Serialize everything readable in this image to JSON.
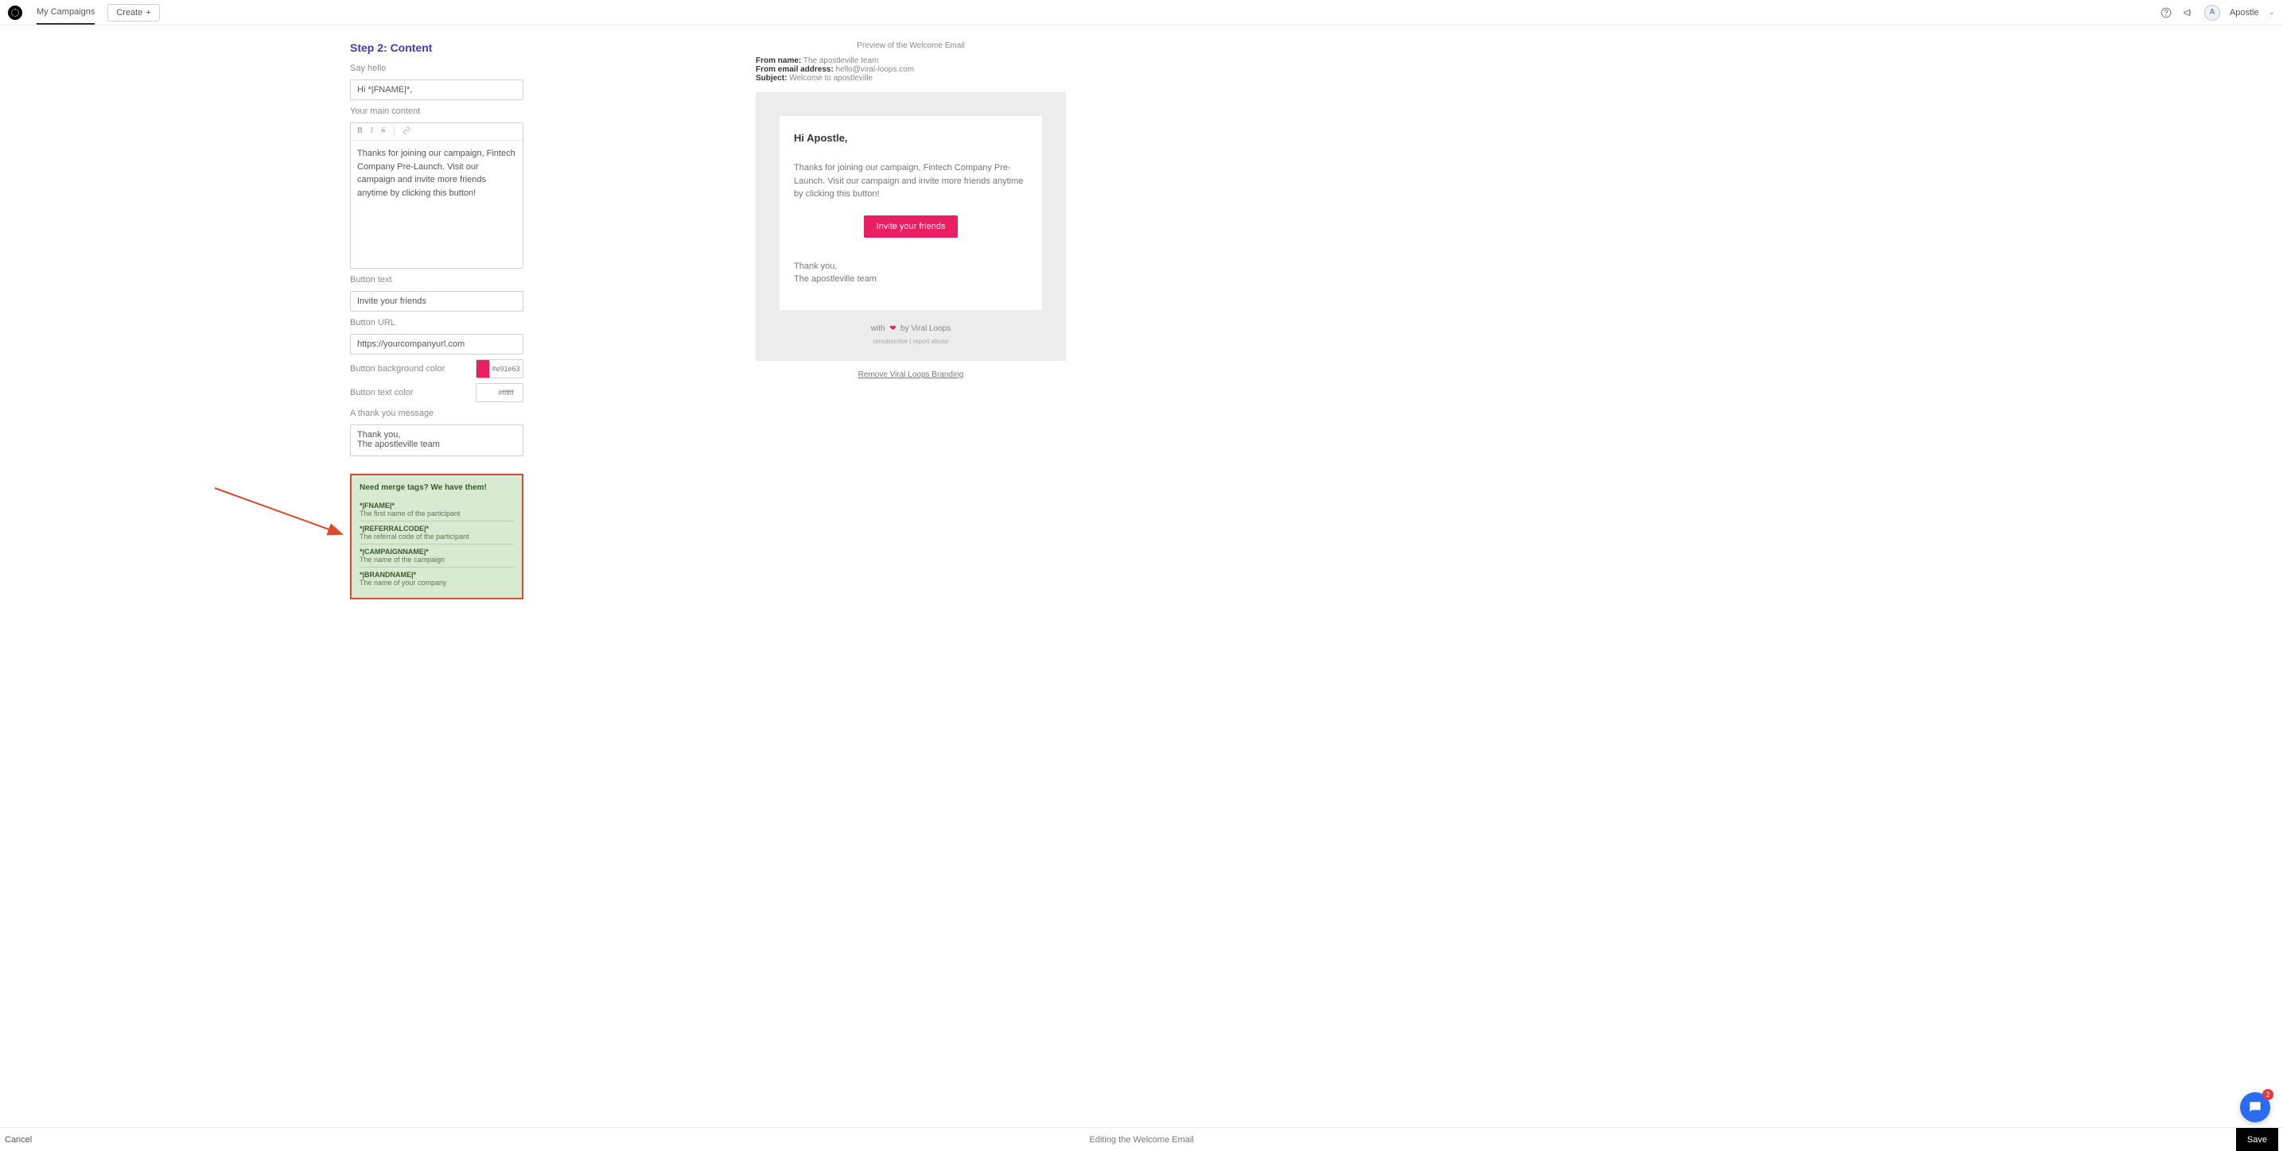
{
  "nav": {
    "link_campaigns": "My Campaigns",
    "create_label": "Create",
    "username": "Apostle",
    "avatar_initial": "A"
  },
  "form": {
    "step_title": "Step 2: Content",
    "say_hello_label": "Say hello",
    "say_hello_value": "Hi *|FNAME|*,",
    "main_content_label": "Your main content",
    "main_content_value": "Thanks for joining our campaign, Fintech Company Pre-Launch. Visit our campaign and invite more friends anytime by clicking this button!",
    "button_text_label": "Button text",
    "button_text_value": "Invite your friends",
    "button_url_label": "Button URL",
    "button_url_value": "https://yourcompanyurl.com",
    "bg_color_label": "Button background color",
    "bg_color_value": "#e91e63",
    "text_color_label": "Button text color",
    "text_color_value": "#ffffff",
    "thank_you_label": "A thank you message",
    "thank_you_line1": "Thank you,",
    "thank_you_line2": "The apostleville team"
  },
  "merge": {
    "title": "Need merge tags? We have them!",
    "tags": [
      {
        "tag": "*|FNAME|*",
        "desc": "The first name of the participant"
      },
      {
        "tag": "*|REFERRALCODE|*",
        "desc": "The referral code of the participant"
      },
      {
        "tag": "*|CAMPAIGNNAME|*",
        "desc": "The name of the campaign"
      },
      {
        "tag": "*|BRANDNAME|*",
        "desc": "The name of your company"
      }
    ]
  },
  "preview": {
    "title": "Preview of the Welcome Email",
    "from_name_label": "From name:",
    "from_name_value": "The apostleville team",
    "from_email_label": "From email address:",
    "from_email_value": "hello@viral-loops.com",
    "subject_label": "Subject:",
    "subject_value": "Welcome to apostleville",
    "greeting": "Hi Apostle,",
    "body_text": "Thanks for joining our campaign, Fintech Company Pre-Launch. Visit our campaign and invite more friends anytime by clicking this button!",
    "cta_label": "Invite your friends",
    "signoff_line1": "Thank you,",
    "signoff_line2": "The apostleville team",
    "branding_prefix": "with",
    "branding_suffix": "by Viral Loops",
    "branding_sub_1": "unsubscribe",
    "branding_sub_sep": " | ",
    "branding_sub_2": "report abuse",
    "remove_branding": "Remove Viral Loops Branding"
  },
  "footer": {
    "cancel": "Cancel",
    "center": "Editing the Welcome Email",
    "save": "Save"
  },
  "intercom": {
    "badge": "2"
  }
}
